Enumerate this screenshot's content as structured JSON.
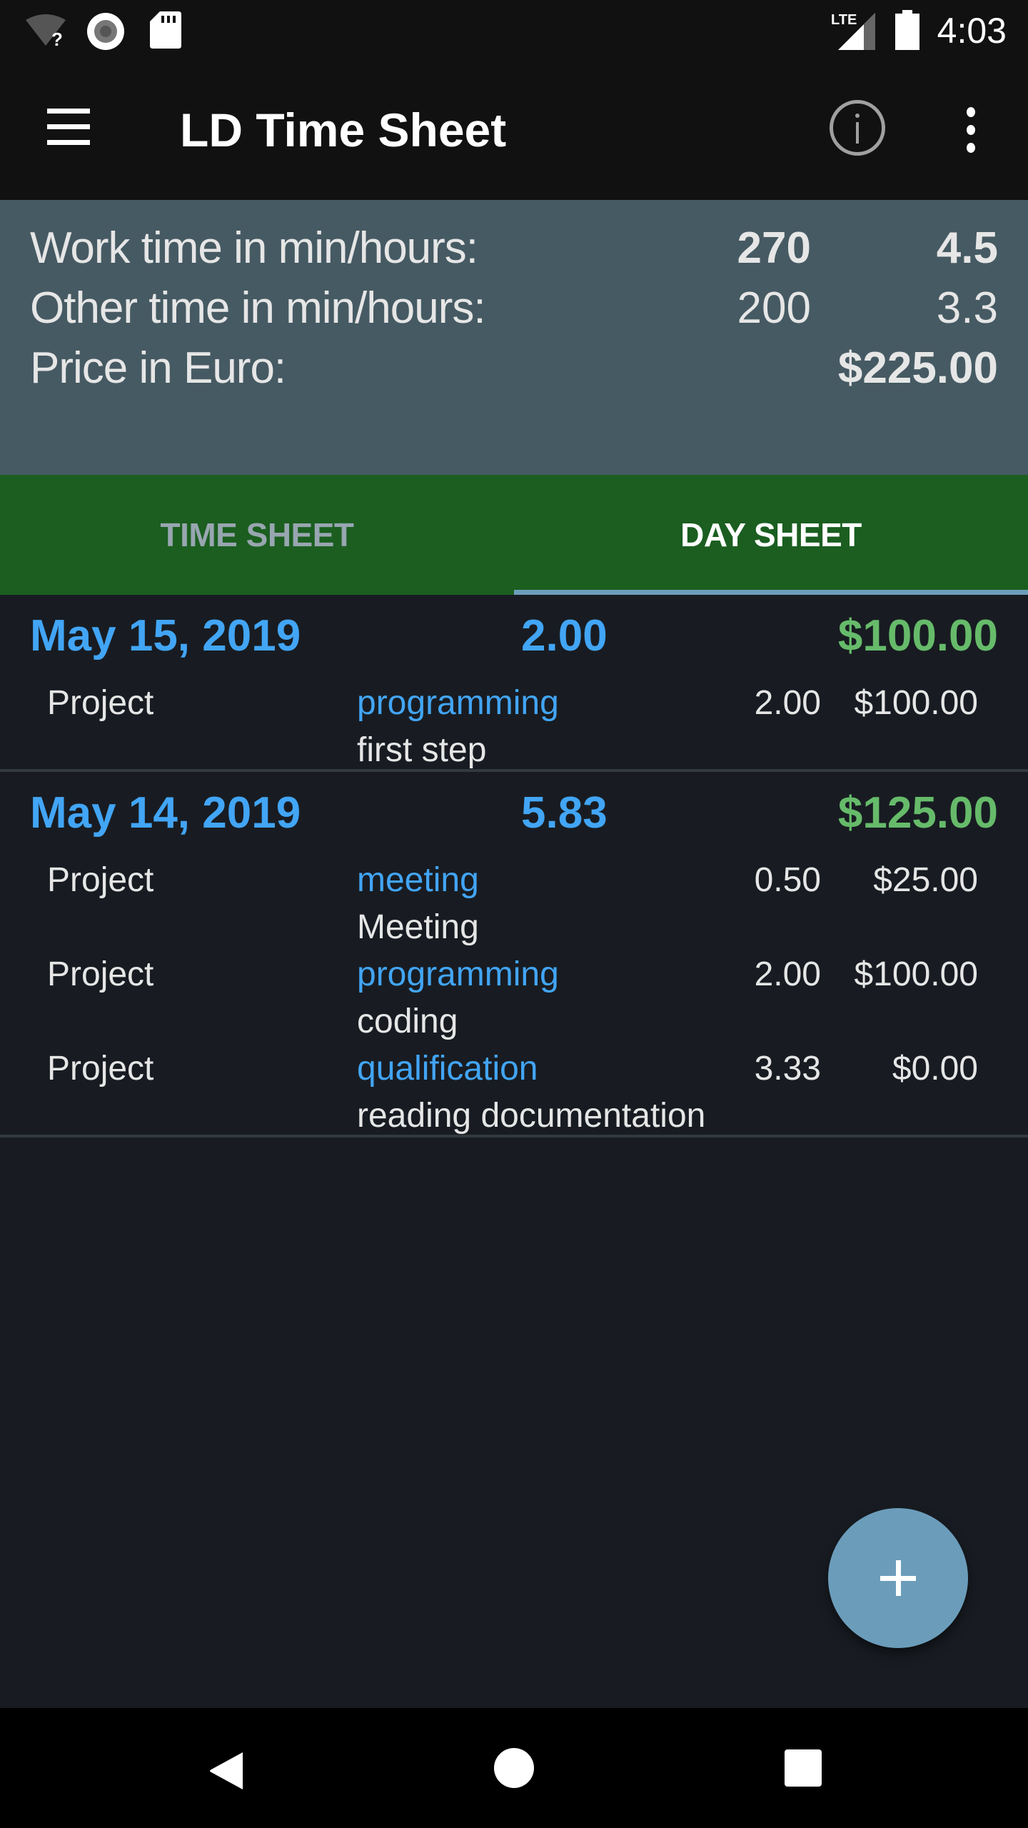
{
  "status_bar": {
    "time": "4:03",
    "network": "LTE",
    "icons": [
      "wifi-unknown-icon",
      "record-icon",
      "sd-card-icon",
      "lte-signal-icon",
      "battery-icon"
    ]
  },
  "app_bar": {
    "title": "LD Time Sheet",
    "icons": [
      "menu-icon",
      "info-icon",
      "more-vert-icon"
    ]
  },
  "summary": {
    "work_time": {
      "label": "Work time in min/hours:",
      "minutes": "270",
      "hours": "4.5"
    },
    "other_time": {
      "label": "Other time in min/hours:",
      "minutes": "200",
      "hours": "3.3"
    },
    "price": {
      "label": "Price in Euro:",
      "value": "$225.00"
    }
  },
  "tabs": [
    {
      "label": "TIME SHEET",
      "active": false
    },
    {
      "label": "DAY SHEET",
      "active": true
    }
  ],
  "days": [
    {
      "date": "May 15, 2019",
      "hours": "2.00",
      "price": "$100.00",
      "entries": [
        {
          "project": "Project",
          "activity": "programming",
          "note": "first step",
          "hours": "2.00",
          "price": "$100.00"
        }
      ]
    },
    {
      "date": "May 14, 2019",
      "hours": "5.83",
      "price": "$125.00",
      "entries": [
        {
          "project": "Project",
          "activity": "meeting",
          "note": "Meeting",
          "hours": "0.50",
          "price": "$25.00"
        },
        {
          "project": "Project",
          "activity": "programming",
          "note": "coding",
          "hours": "2.00",
          "price": "$100.00"
        },
        {
          "project": "Project",
          "activity": "qualification",
          "note": "reading documentation",
          "hours": "3.33",
          "price": "$0.00"
        }
      ]
    }
  ],
  "fab": {
    "icon": "plus-icon"
  },
  "nav_bar": {
    "icons": [
      "back-icon",
      "home-icon",
      "recents-icon"
    ]
  },
  "colors": {
    "accent_blue": "#42a5f5",
    "price_green": "#66bb6a",
    "tab_green": "#1b5e20",
    "summary_bg": "#465a63",
    "fab": "#6b9dba"
  }
}
